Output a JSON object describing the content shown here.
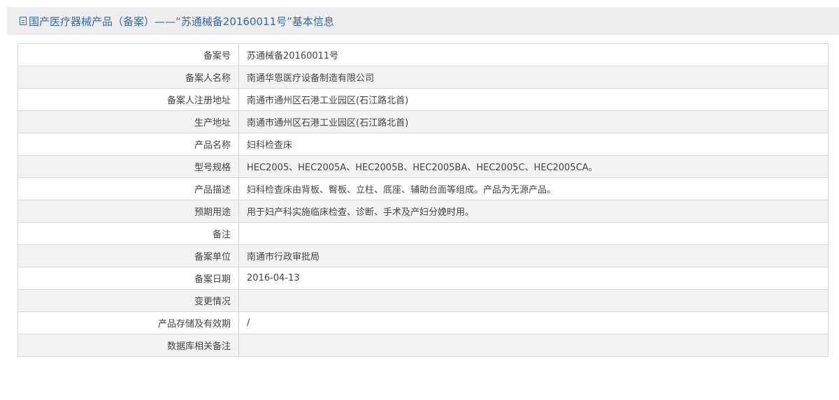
{
  "header": {
    "icon": "document-icon",
    "title": "国产医疗器械产品（备案）——“苏通械备20160011号”基本信息"
  },
  "rows": [
    {
      "label": "备案号",
      "value": "苏通械备20160011号"
    },
    {
      "label": "备案人名称",
      "value": "南通华恩医疗设备制造有限公司"
    },
    {
      "label": "备案人注册地址",
      "value": "南通市通州区石港工业园区(石江路北首)"
    },
    {
      "label": "生产地址",
      "value": "南通市通州区石港工业园区(石江路北首)"
    },
    {
      "label": "产品名称",
      "value": "妇科检查床"
    },
    {
      "label": "型号规格",
      "value": "HEC2005、HEC2005A、HEC2005B、HEC2005BA、HEC2005C、HEC2005CA。"
    },
    {
      "label": "产品描述",
      "value": "妇科检查床由背板、臀板、立柱、底座、辅助台面等组成。产品为无源产品。"
    },
    {
      "label": "预期用途",
      "value": "用于妇产科实施临床检查、诊断、手术及产妇分娩时用。"
    },
    {
      "label": "备注",
      "value": ""
    },
    {
      "label": "备案单位",
      "value": "南通市行政审批局"
    },
    {
      "label": "备案日期",
      "value": "2016-04-13"
    },
    {
      "label": "变更情况",
      "value": ""
    },
    {
      "label": "产品存储及有效期",
      "value": "/"
    },
    {
      "label": "数据库相关备注",
      "value": ""
    }
  ],
  "colors": {
    "title": "#2f6ab5",
    "header_bg": "#eeeeee",
    "row_alt_bg": "#f3f3f3",
    "border": "#d6d6d6"
  }
}
